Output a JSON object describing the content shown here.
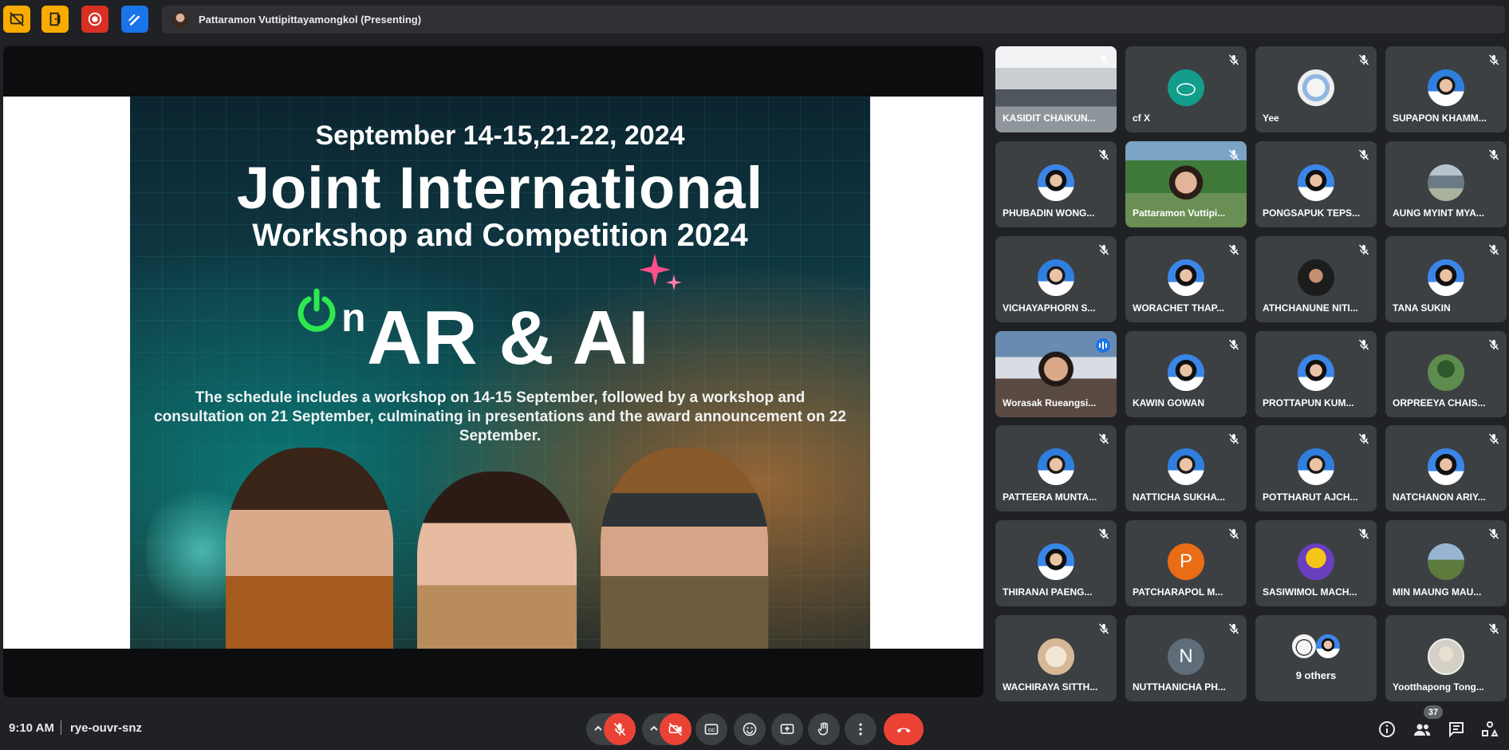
{
  "presenting_banner": "Pattaramon Vuttipittayamongkol (Presenting)",
  "slide": {
    "date": "September 14-15,21-22, 2024",
    "title": "Joint International",
    "subtitle": "Workshop and Competition 2024",
    "on_n": "n",
    "ar_ai": "AR & AI",
    "description": "The schedule includes a workshop on 14-15 September, followed by a workshop and consultation on 21 September, culminating in presentations and the award announcement on 22 September."
  },
  "participants": [
    {
      "name": "KASIDIT CHAIKUN...",
      "avatar": "photo-office"
    },
    {
      "name": "cf X",
      "avatar": "teal-logo"
    },
    {
      "name": "Yee",
      "avatar": "anime"
    },
    {
      "name": "SUPAPON KHAMM...",
      "avatar": "student-f"
    },
    {
      "name": "PHUBADIN WONG...",
      "avatar": "student-m"
    },
    {
      "name": "Pattaramon Vuttipi...",
      "avatar": "photo-garden"
    },
    {
      "name": "PONGSAPUK TEPS...",
      "avatar": "student-m"
    },
    {
      "name": "AUNG MYINT MYA...",
      "avatar": "building"
    },
    {
      "name": "VICHAYAPHORN S...",
      "avatar": "student-f"
    },
    {
      "name": "WORACHET THAP...",
      "avatar": "student-m"
    },
    {
      "name": "ATHCHANUNE NITI...",
      "avatar": "dark"
    },
    {
      "name": "TANA SUKIN",
      "avatar": "student-m"
    },
    {
      "name": "Worasak Rueangsi...",
      "avatar": "photo-worasak",
      "speaking": true
    },
    {
      "name": "KAWIN GOWAN",
      "avatar": "student-m"
    },
    {
      "name": "PROTTAPUN KUM...",
      "avatar": "student-m"
    },
    {
      "name": "ORPREEYA CHAIS...",
      "avatar": "nature"
    },
    {
      "name": "PATTEERA MUNTA...",
      "avatar": "student-f"
    },
    {
      "name": "NATTICHA SUKHA...",
      "avatar": "student-f"
    },
    {
      "name": "POTTHARUT AJCH...",
      "avatar": "student-f"
    },
    {
      "name": "NATCHANON ARIY...",
      "avatar": "student-m"
    },
    {
      "name": "THIRANAI PAENG...",
      "avatar": "student-m"
    },
    {
      "name": "PATCHARAPOL M...",
      "avatar": "letter",
      "initial": "P"
    },
    {
      "name": "SASIWIMOL MACH...",
      "avatar": "sunset"
    },
    {
      "name": "MIN MAUNG MAU...",
      "avatar": "landscape"
    },
    {
      "name": "WACHIRAYA SITTH...",
      "avatar": "cat"
    },
    {
      "name": "NUTTHANICHA PH...",
      "avatar": "letter",
      "initial": "N"
    },
    {
      "name": "9 others",
      "avatar": "others"
    },
    {
      "name": "Yootthapong Tong...",
      "avatar": "sketch"
    }
  ],
  "bottom": {
    "time": "9:10 AM",
    "meeting_code": "rye-ouvr-snz",
    "people_count": "37"
  },
  "colors": {
    "background": "#202124",
    "tile": "#3c4043",
    "danger": "#ea4335",
    "accent": "#8ab4f8",
    "tool_yellow": "#f9ab00",
    "tool_red": "#d93025",
    "tool_blue": "#1a73e8"
  }
}
